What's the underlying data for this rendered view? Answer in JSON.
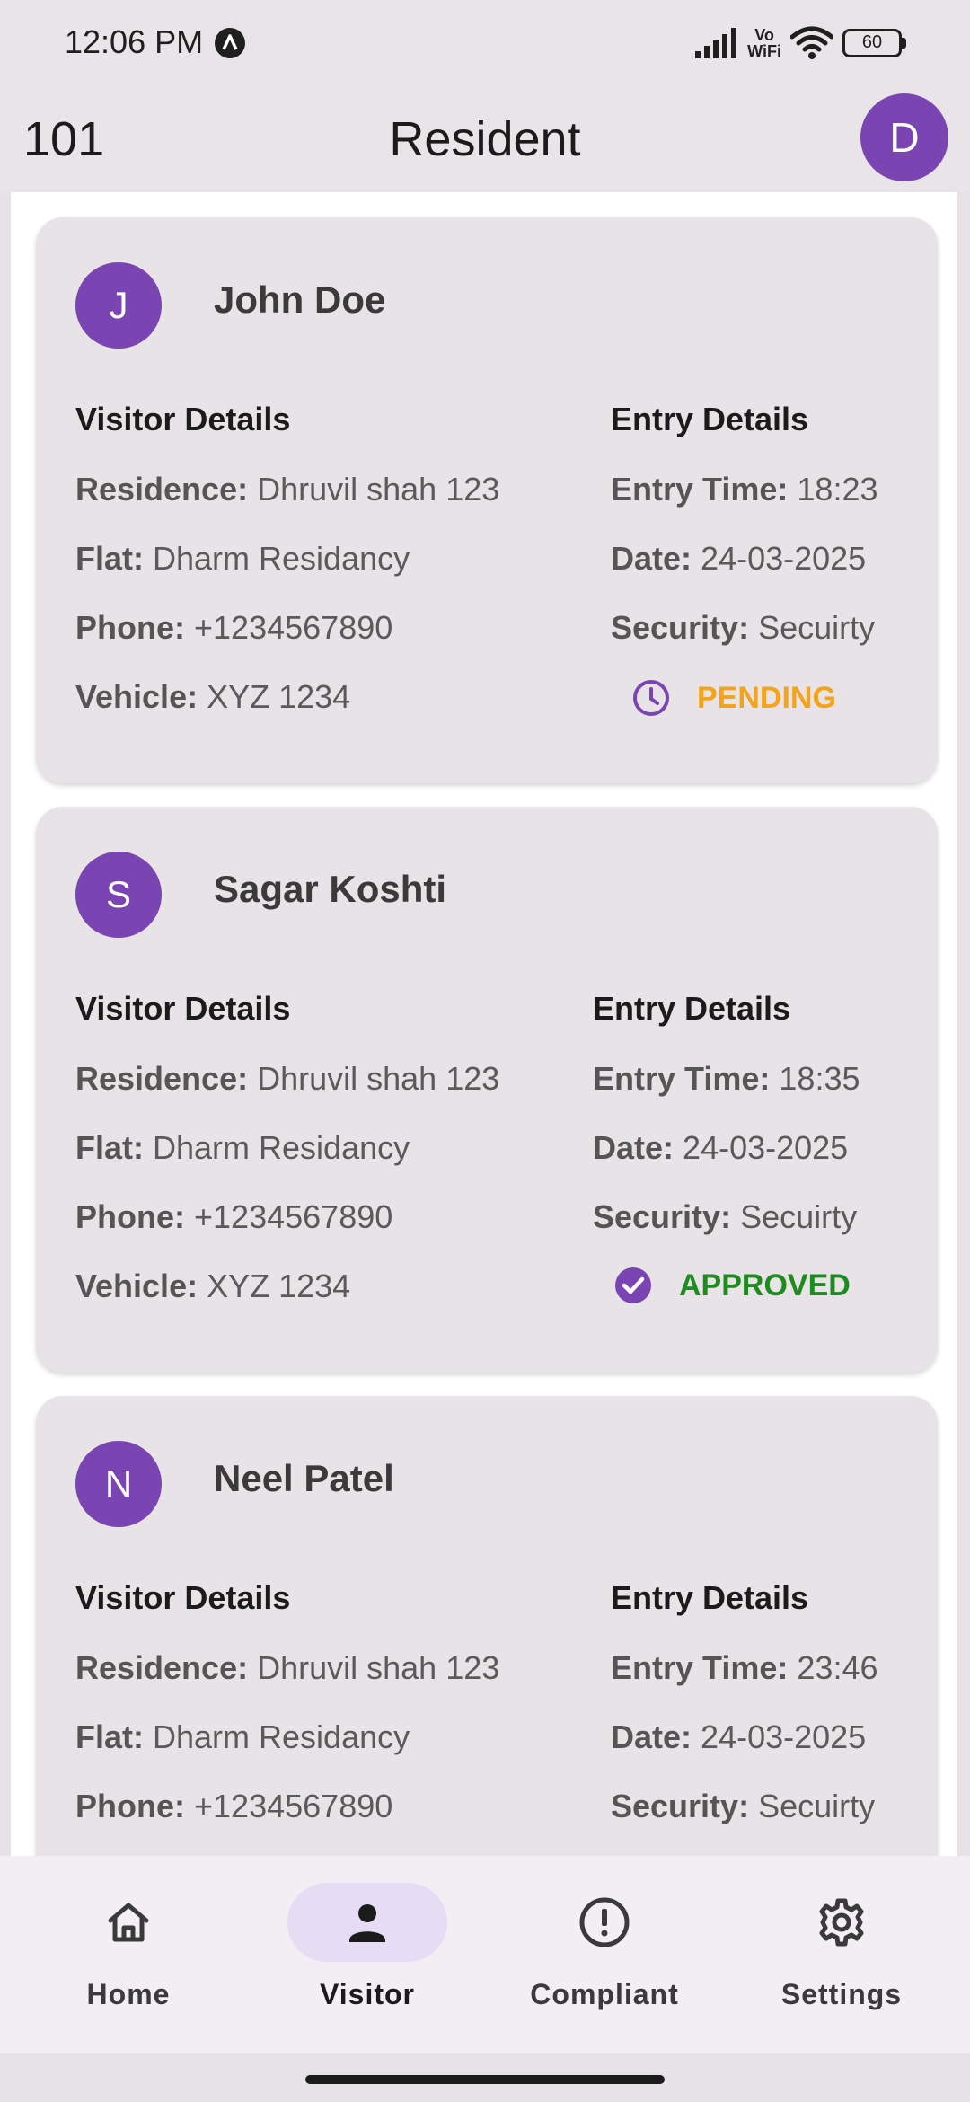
{
  "status_bar": {
    "time": "12:06 PM",
    "vowifi": "Vo WiFi",
    "battery": "60"
  },
  "app_bar": {
    "flat_number": "101",
    "title": "Resident",
    "avatar_letter": "D"
  },
  "labels": {
    "visitor_details": "Visitor Details",
    "entry_details": "Entry Details",
    "residence": "Residence:",
    "flat": "Flat:",
    "phone": "Phone:",
    "vehicle": "Vehicle:",
    "entry_time": "Entry Time:",
    "date": "Date:",
    "security": "Security:"
  },
  "visitors": [
    {
      "initial": "J",
      "name": "John Doe",
      "residence": "Dhruvil shah 123",
      "flat": "Dharm Residancy",
      "phone": "+1234567890",
      "vehicle": "XYZ 1234",
      "entry_time": "18:23",
      "date": "24-03-2025",
      "security": "Secuirty",
      "status": "PENDING",
      "status_icon": "clock-icon"
    },
    {
      "initial": "S",
      "name": "Sagar Koshti",
      "residence": "Dhruvil shah 123",
      "flat": "Dharm Residancy",
      "phone": "+1234567890",
      "vehicle": "XYZ 1234",
      "entry_time": "18:35",
      "date": "24-03-2025",
      "security": "Secuirty",
      "status": "APPROVED",
      "status_icon": "check-circle-icon"
    },
    {
      "initial": "N",
      "name": "Neel Patel",
      "residence": "Dhruvil shah 123",
      "flat": "Dharm Residancy",
      "phone": "+1234567890",
      "entry_time": "23:46",
      "date": "24-03-2025",
      "security": "Secuirty"
    }
  ],
  "bottom_nav": [
    {
      "label": "Home",
      "icon": "home-icon"
    },
    {
      "label": "Visitor",
      "icon": "person-icon",
      "active": true
    },
    {
      "label": "Compliant",
      "icon": "alert-circle-icon"
    },
    {
      "label": "Settings",
      "icon": "gear-icon"
    }
  ],
  "colors": {
    "accent": "#7a44b3",
    "pending": "#f3a41c",
    "approved": "#1f8a1f",
    "card_bg": "#e7e3e6",
    "nav_active_pill": "#e6ddf5"
  }
}
